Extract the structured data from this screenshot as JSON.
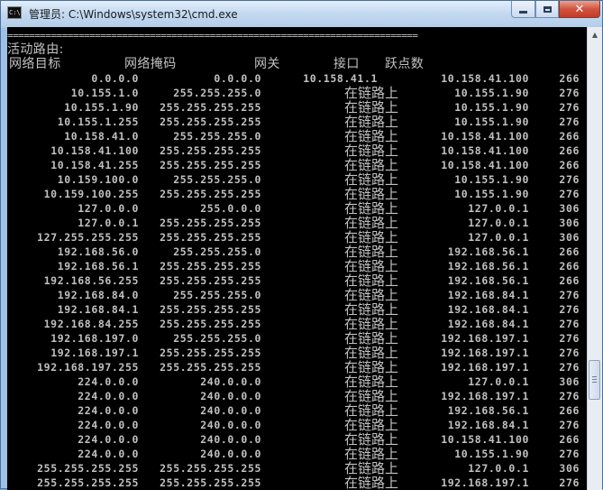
{
  "window": {
    "title": "管理员: C:\\Windows\\system32\\cmd.exe",
    "icon": "cmd-icon",
    "app_icon_text": "C:\\",
    "controls": {
      "minimize": "minimize-icon",
      "maximize": "maximize-icon",
      "close": "✕"
    }
  },
  "console": {
    "separator": "===========================================================================",
    "section_title": "活动路由:",
    "headers": {
      "destination": "网络目标",
      "netmask": "网络掩码",
      "gateway": "网关",
      "interface": "接口",
      "metric": "跃点数"
    },
    "routes": [
      {
        "destination": "0.0.0.0",
        "netmask": "0.0.0.0",
        "gateway": "10.158.41.1",
        "interface": "10.158.41.100",
        "metric": "266"
      },
      {
        "destination": "10.155.1.0",
        "netmask": "255.255.255.0",
        "gateway": "在链路上",
        "interface": "10.155.1.90",
        "metric": "276"
      },
      {
        "destination": "10.155.1.90",
        "netmask": "255.255.255.255",
        "gateway": "在链路上",
        "interface": "10.155.1.90",
        "metric": "276"
      },
      {
        "destination": "10.155.1.255",
        "netmask": "255.255.255.255",
        "gateway": "在链路上",
        "interface": "10.155.1.90",
        "metric": "276"
      },
      {
        "destination": "10.158.41.0",
        "netmask": "255.255.255.0",
        "gateway": "在链路上",
        "interface": "10.158.41.100",
        "metric": "266"
      },
      {
        "destination": "10.158.41.100",
        "netmask": "255.255.255.255",
        "gateway": "在链路上",
        "interface": "10.158.41.100",
        "metric": "266"
      },
      {
        "destination": "10.158.41.255",
        "netmask": "255.255.255.255",
        "gateway": "在链路上",
        "interface": "10.158.41.100",
        "metric": "266"
      },
      {
        "destination": "10.159.100.0",
        "netmask": "255.255.255.0",
        "gateway": "在链路上",
        "interface": "10.155.1.90",
        "metric": "276"
      },
      {
        "destination": "10.159.100.255",
        "netmask": "255.255.255.255",
        "gateway": "在链路上",
        "interface": "10.155.1.90",
        "metric": "276"
      },
      {
        "destination": "127.0.0.0",
        "netmask": "255.0.0.0",
        "gateway": "在链路上",
        "interface": "127.0.0.1",
        "metric": "306"
      },
      {
        "destination": "127.0.0.1",
        "netmask": "255.255.255.255",
        "gateway": "在链路上",
        "interface": "127.0.0.1",
        "metric": "306"
      },
      {
        "destination": "127.255.255.255",
        "netmask": "255.255.255.255",
        "gateway": "在链路上",
        "interface": "127.0.0.1",
        "metric": "306"
      },
      {
        "destination": "192.168.56.0",
        "netmask": "255.255.255.0",
        "gateway": "在链路上",
        "interface": "192.168.56.1",
        "metric": "266"
      },
      {
        "destination": "192.168.56.1",
        "netmask": "255.255.255.255",
        "gateway": "在链路上",
        "interface": "192.168.56.1",
        "metric": "266"
      },
      {
        "destination": "192.168.56.255",
        "netmask": "255.255.255.255",
        "gateway": "在链路上",
        "interface": "192.168.56.1",
        "metric": "266"
      },
      {
        "destination": "192.168.84.0",
        "netmask": "255.255.255.0",
        "gateway": "在链路上",
        "interface": "192.168.84.1",
        "metric": "276"
      },
      {
        "destination": "192.168.84.1",
        "netmask": "255.255.255.255",
        "gateway": "在链路上",
        "interface": "192.168.84.1",
        "metric": "276"
      },
      {
        "destination": "192.168.84.255",
        "netmask": "255.255.255.255",
        "gateway": "在链路上",
        "interface": "192.168.84.1",
        "metric": "276"
      },
      {
        "destination": "192.168.197.0",
        "netmask": "255.255.255.0",
        "gateway": "在链路上",
        "interface": "192.168.197.1",
        "metric": "276"
      },
      {
        "destination": "192.168.197.1",
        "netmask": "255.255.255.255",
        "gateway": "在链路上",
        "interface": "192.168.197.1",
        "metric": "276"
      },
      {
        "destination": "192.168.197.255",
        "netmask": "255.255.255.255",
        "gateway": "在链路上",
        "interface": "192.168.197.1",
        "metric": "276"
      },
      {
        "destination": "224.0.0.0",
        "netmask": "240.0.0.0",
        "gateway": "在链路上",
        "interface": "127.0.0.1",
        "metric": "306"
      },
      {
        "destination": "224.0.0.0",
        "netmask": "240.0.0.0",
        "gateway": "在链路上",
        "interface": "192.168.197.1",
        "metric": "276"
      },
      {
        "destination": "224.0.0.0",
        "netmask": "240.0.0.0",
        "gateway": "在链路上",
        "interface": "192.168.56.1",
        "metric": "266"
      },
      {
        "destination": "224.0.0.0",
        "netmask": "240.0.0.0",
        "gateway": "在链路上",
        "interface": "192.168.84.1",
        "metric": "276"
      },
      {
        "destination": "224.0.0.0",
        "netmask": "240.0.0.0",
        "gateway": "在链路上",
        "interface": "10.158.41.100",
        "metric": "266"
      },
      {
        "destination": "224.0.0.0",
        "netmask": "240.0.0.0",
        "gateway": "在链路上",
        "interface": "10.155.1.90",
        "metric": "276"
      },
      {
        "destination": "255.255.255.255",
        "netmask": "255.255.255.255",
        "gateway": "在链路上",
        "interface": "127.0.0.1",
        "metric": "306"
      },
      {
        "destination": "255.255.255.255",
        "netmask": "255.255.255.255",
        "gateway": "在链路上",
        "interface": "192.168.197.1",
        "metric": "276"
      }
    ]
  },
  "colors": {
    "console_bg": "#000000",
    "console_fg": "#c0c0c0",
    "close_button": "#c7432d"
  }
}
